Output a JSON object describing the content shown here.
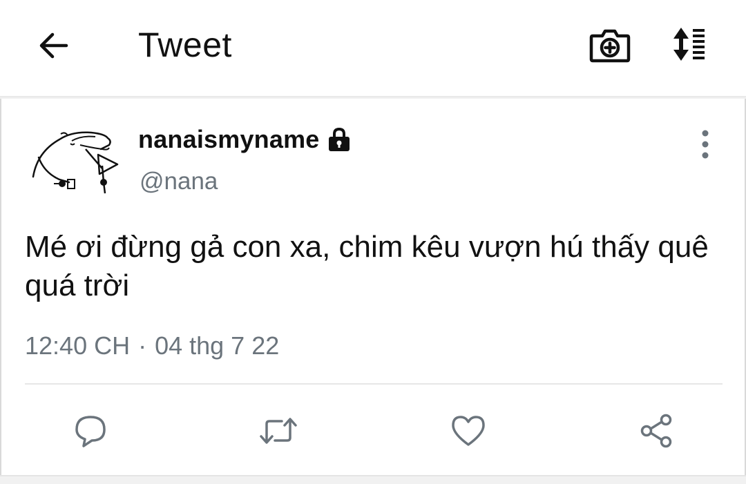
{
  "header": {
    "back_icon": "arrow-left-icon",
    "title": "Tweet",
    "camera_icon": "camera-plus-icon",
    "sort_icon": "sort-lines-icon"
  },
  "tweet": {
    "author": {
      "display_name": "nanaismyname",
      "handle": "@nana",
      "protected_icon": "lock-icon",
      "avatar_icon": "avatar-doodle-icon"
    },
    "text": "Mé ơi đừng gả con xa, chim kêu vượn hú thấy quê quá trời",
    "time": "12:40 CH",
    "separator": "·",
    "date": "04 thg 7 22",
    "more_icon": "more-vertical-icon"
  },
  "actions": {
    "reply_icon": "reply-icon",
    "retweet_icon": "retweet-icon",
    "like_icon": "heart-icon",
    "share_icon": "share-icon"
  },
  "colors": {
    "icon": "#111111",
    "secondary_text": "#6b747c",
    "action_icon": "#6b747c",
    "divider": "#e7e7e7"
  }
}
